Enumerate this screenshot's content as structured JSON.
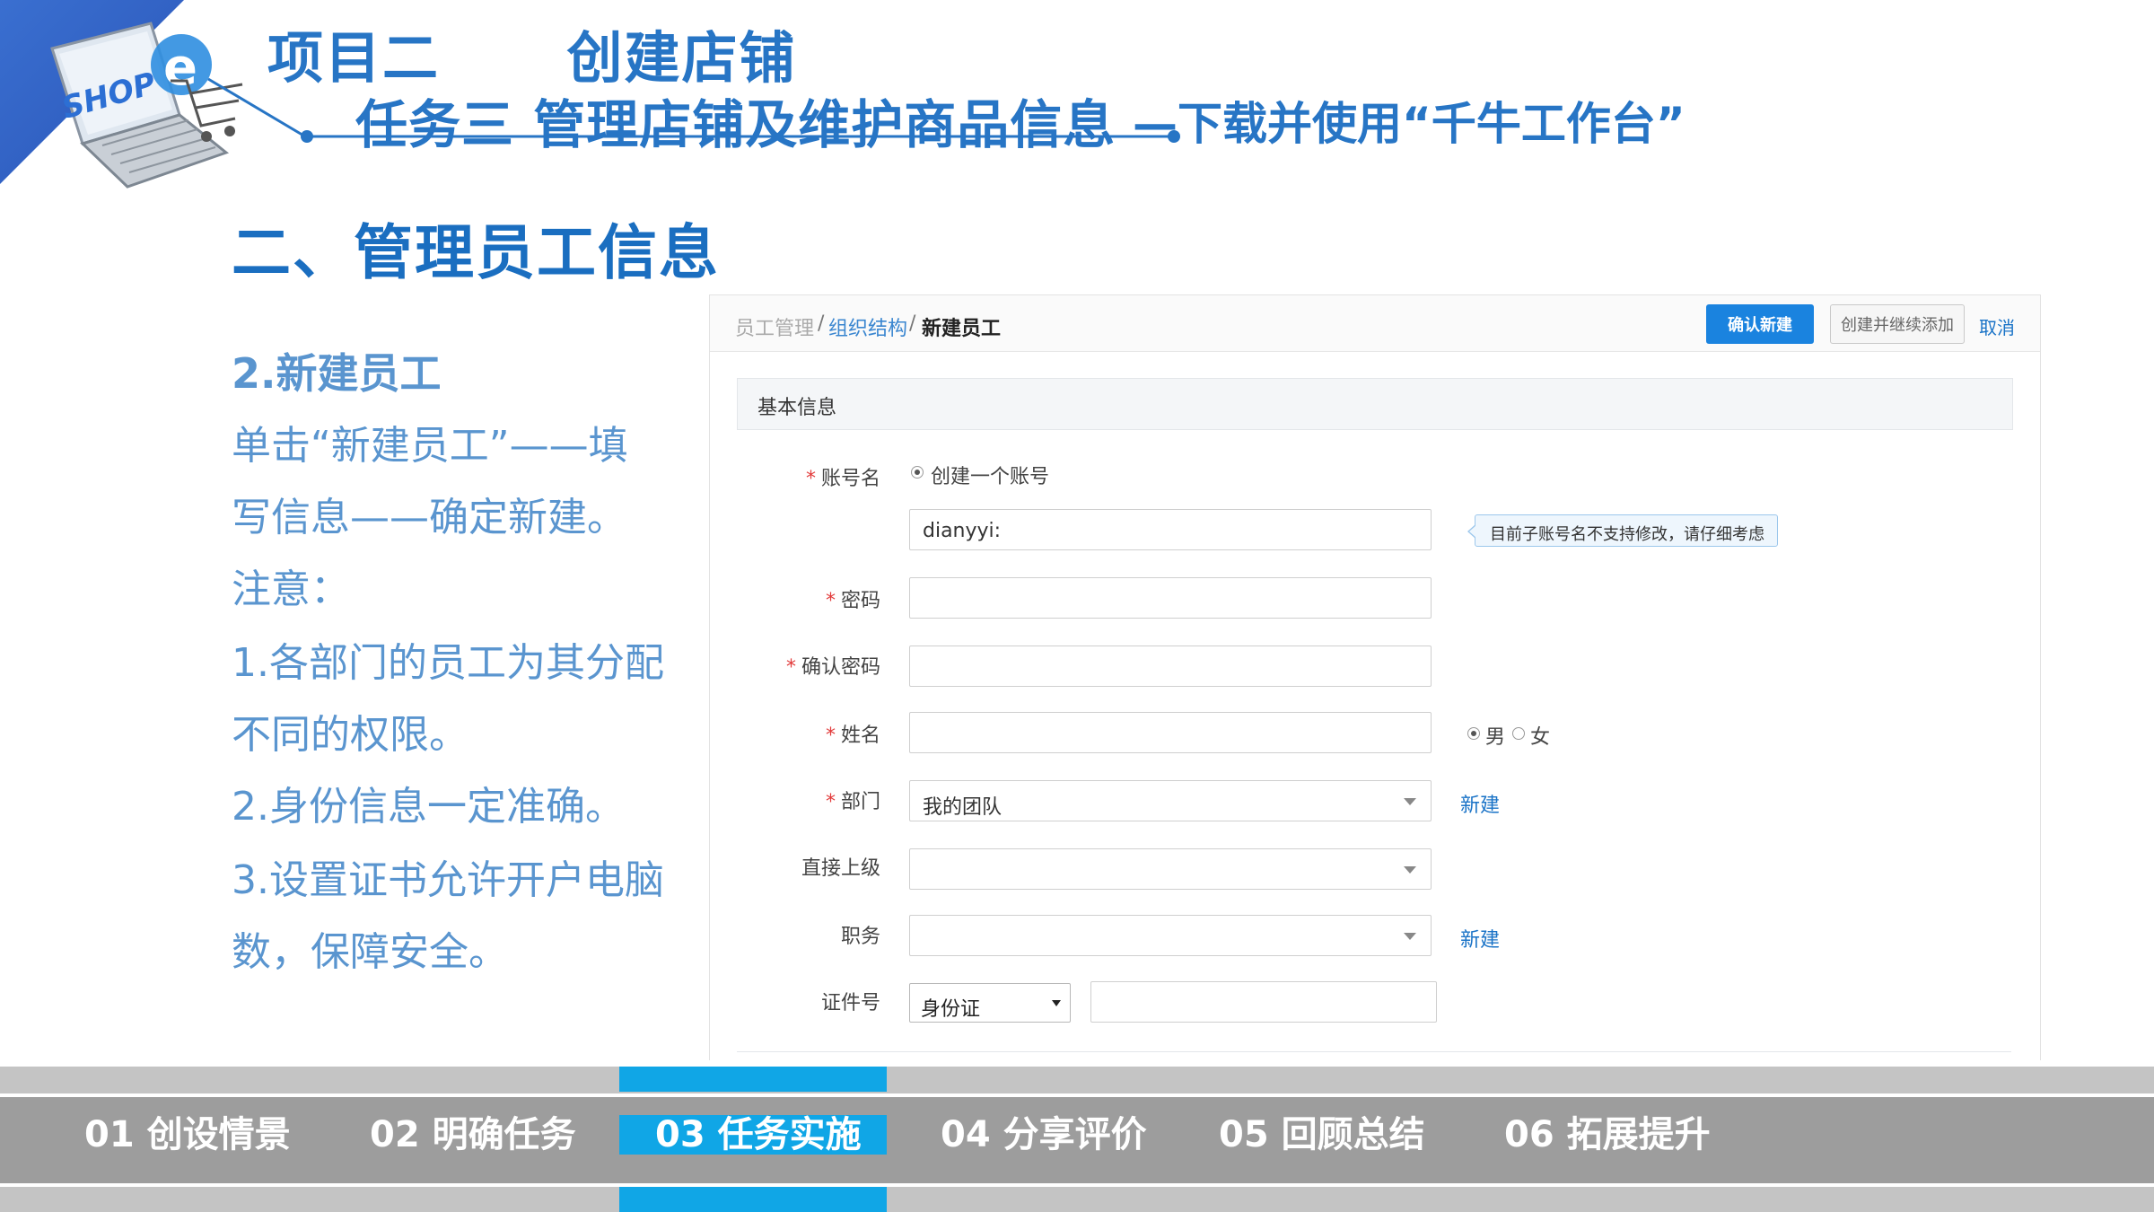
{
  "header": {
    "project_title": "项目二      创建店铺",
    "task_title": "任务三  管理店铺及维护商品信息",
    "task_subtitle": "—下载并使用“千牛工作台”",
    "logo_text": "SHOP",
    "accent_color": "#2775c5"
  },
  "section_title": "二、管理员工信息",
  "instructions": {
    "step_title": "2.新建员工",
    "lines": [
      "单击“新建员工”——填",
      "写信息——确定新建。",
      "注意：",
      "1.各部门的员工为其分配",
      "不同的权限。",
      "2.身份信息一定准确。",
      "3.设置证书允许开户电脑",
      "数，保障安全。"
    ]
  },
  "form_screen": {
    "breadcrumb": {
      "item1": "员工管理",
      "sep": "/",
      "item2": "组织结构",
      "item3": "新建员工"
    },
    "buttons": {
      "confirm": "确认新建",
      "create_continue": "创建并继续添加",
      "cancel": "取消"
    },
    "section_header": "基本信息",
    "required_mark": "*",
    "fields": {
      "account": {
        "label": "账号名",
        "radio_option": "创建一个账号",
        "value": "dianyyi:",
        "tip": "目前子账号名不支持修改，请仔细考虑"
      },
      "password": {
        "label": "密码",
        "value": ""
      },
      "confirm_password": {
        "label": "确认密码",
        "value": ""
      },
      "name": {
        "label": "姓名",
        "value": "",
        "gender_options": [
          "男",
          "女"
        ],
        "gender_selected": "男"
      },
      "department": {
        "label": "部门",
        "value": "我的团队",
        "new_link": "新建"
      },
      "supervisor": {
        "label": "直接上级",
        "value": ""
      },
      "position": {
        "label": "职务",
        "value": "",
        "new_link": "新建"
      },
      "id_number": {
        "label": "证件号",
        "id_type": "身份证",
        "value": ""
      }
    }
  },
  "bottom_nav": {
    "items": [
      "01 创设情景",
      "02 明确任务",
      "03 任务实施",
      "04 分享评价",
      "05 回顾总结",
      "06 拓展提升"
    ],
    "active_index": 2,
    "active_color": "#10a6e6",
    "bar_color": "#9d9d9d"
  }
}
